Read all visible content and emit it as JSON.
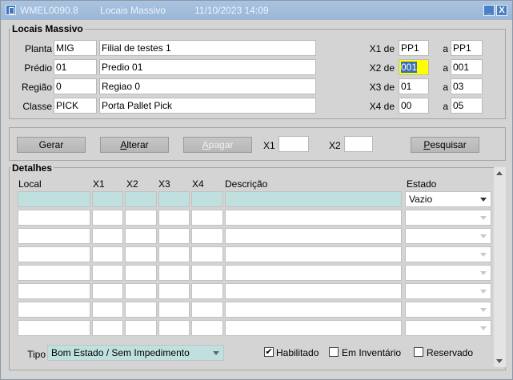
{
  "titlebar": {
    "app_code": "WMEL0090.8",
    "form_name": "Locais Massivo",
    "datetime": "11/10/2023 14:09",
    "minimize": "_",
    "close": "X"
  },
  "header_frame": {
    "title": "Locais Massivo",
    "planta": {
      "label": "Planta",
      "code": "MIG",
      "desc": "Filial de testes 1"
    },
    "predio": {
      "label": "Prédio",
      "code": "01",
      "desc": "Predio 01"
    },
    "regiao": {
      "label": "Região",
      "code": "0",
      "desc": "Regiao 0"
    },
    "classe": {
      "label": "Classe",
      "code": "PICK",
      "desc": "Porta Pallet Pick"
    },
    "x1": {
      "label": "X1 de",
      "from": "PP1",
      "to_label": "a",
      "to": "PP1"
    },
    "x2": {
      "label": "X2 de",
      "from": "001",
      "to_label": "a",
      "to": "001"
    },
    "x3": {
      "label": "X3 de",
      "from": "01",
      "to_label": "a",
      "to": "03"
    },
    "x4": {
      "label": "X4 de",
      "from": "00",
      "to_label": "a",
      "to": "05"
    }
  },
  "actions": {
    "gerar": "Gerar",
    "alterar_underlined": "A",
    "alterar_rest": "lterar",
    "apagar_underlined": "A",
    "apagar_rest": "pagar",
    "x1_label": "X1",
    "x1_value": "",
    "x2_label": "X2",
    "x2_value": "",
    "pesquisar_underlined": "P",
    "pesquisar_rest": "esquisar"
  },
  "detalhes": {
    "title": "Detalhes",
    "columns": [
      "Local",
      "X1",
      "X2",
      "X3",
      "X4",
      "Descrição",
      "Estado"
    ],
    "first_row_estado": "Vazio",
    "tipo_label": "Tipo",
    "tipo_value": "Bom Estado / Sem Impedimento",
    "habilitado": {
      "label": "Habilitado",
      "checked": true
    },
    "em_inventario": {
      "label": "Em Inventário",
      "checked": false
    },
    "reservado": {
      "label": "Reservado",
      "checked": false
    },
    "check_mark": "✔"
  }
}
